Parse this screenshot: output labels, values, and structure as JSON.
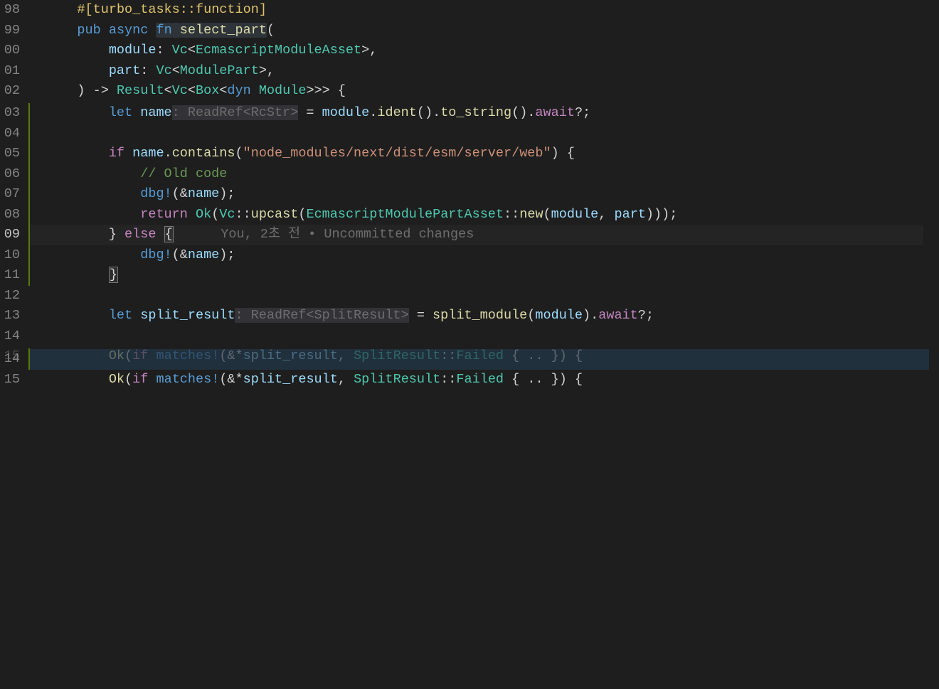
{
  "lineNumbers": [
    "98",
    "99",
    "00",
    "01",
    "02",
    "03",
    "04",
    "05",
    "06",
    "07",
    "08",
    "09",
    "10",
    "11",
    "12",
    "13",
    "14",
    "15",
    "14",
    "15"
  ],
  "rowTops": [
    0,
    28.5,
    57,
    85.5,
    114,
    145,
    173.5,
    202,
    230.5,
    259,
    287.5,
    316,
    344.5,
    373,
    401.5,
    430,
    458.5,
    486.6,
    491,
    519.5
  ],
  "code": {
    "l98": {
      "ind": "    ",
      "at1": "#[",
      "at2": "turbo_tasks",
      "at3": "::",
      "at4": "function",
      "at5": "]"
    },
    "l99": {
      "ind": "    ",
      "kw1": "pub",
      "sp": " ",
      "kw2": "async",
      "sp2": " ",
      "fnkw": "fn",
      "sp3": " ",
      "fname": "select_part",
      "paren": "("
    },
    "l00": {
      "ind": "        ",
      "p1": "module",
      "c1": ": ",
      "t1": "Vc",
      "a1": "<",
      "t2": "EcmascriptModuleAsset",
      "a2": ">,"
    },
    "l01": {
      "ind": "        ",
      "p1": "part",
      "c1": ": ",
      "t1": "Vc",
      "a1": "<",
      "t2": "ModulePart",
      "a2": ">,"
    },
    "l02": {
      "ind": "    ",
      "p1": ") -> ",
      "t1": "Result",
      "a1": "<",
      "t2": "Vc",
      "a2": "<",
      "t3": "Box",
      "a3": "<",
      "dyn": "dyn",
      "sp": " ",
      "t4": "Module",
      "a4": ">>> {"
    },
    "l03": {
      "ind": "        ",
      "let": "let",
      "sp": " ",
      "v": "name",
      "hint": ": ReadRef<RcStr>",
      "eq": " = ",
      "m": "module",
      "dot": ".",
      "fn1": "ident",
      "p1": "().",
      "fn2": "to_string",
      "p2": "().",
      "aw": "await",
      "q": "?;"
    },
    "l05": {
      "ind": "        ",
      "if": "if",
      "sp": " ",
      "v": "name",
      "dot": ".",
      "fn": "contains",
      "p": "(",
      "str": "\"node_modules/next/dist/esm/server/web\"",
      "p2": ") {"
    },
    "l06": {
      "ind": "            ",
      "cm": "// Old code"
    },
    "l07": {
      "ind": "            ",
      "mc": "dbg!",
      "p": "(&",
      "v": "name",
      "p2": ");"
    },
    "l08": {
      "ind": "            ",
      "ret": "return",
      "sp": " ",
      "ok": "Ok",
      "p": "(",
      "t1": "Vc",
      "cc": "::",
      "fn": "upcast",
      "p2": "(",
      "t2": "EcmascriptModulePartAsset",
      "cc2": "::",
      "fn2": "new",
      "p3": "(",
      "v1": "module",
      "c": ", ",
      "v2": "part",
      "p4": ")));"
    },
    "l09": {
      "ind": "        ",
      "b1": "}",
      "sp": " ",
      "else": "else",
      "sp2": " ",
      "b2": "{",
      "blame": "      You, 2초 전 • Uncommitted changes"
    },
    "l10": {
      "ind": "            ",
      "mc": "dbg!",
      "p": "(&",
      "v": "name",
      "p2": ");"
    },
    "l11": {
      "ind": "        ",
      "b": "}"
    },
    "l13": {
      "ind": "        ",
      "let": "let",
      "sp": " ",
      "v": "split_result",
      "hint": ": ReadRef<SplitResult>",
      "eq": " = ",
      "fn": "split_module",
      "p": "(",
      "v2": "module",
      "p2": ").",
      "aw": "await",
      "q": "?;"
    },
    "l15": {
      "ind": "        ",
      "ok": "Ok",
      "p": "(",
      "if": "if",
      "sp": " ",
      "mc": "matches!",
      "p2": "(&*",
      "v": "split_result",
      "c": ", ",
      "t": "SplitResult",
      "cc": "::",
      "va": "Failed",
      "sp2": " { .. }) {"
    }
  }
}
